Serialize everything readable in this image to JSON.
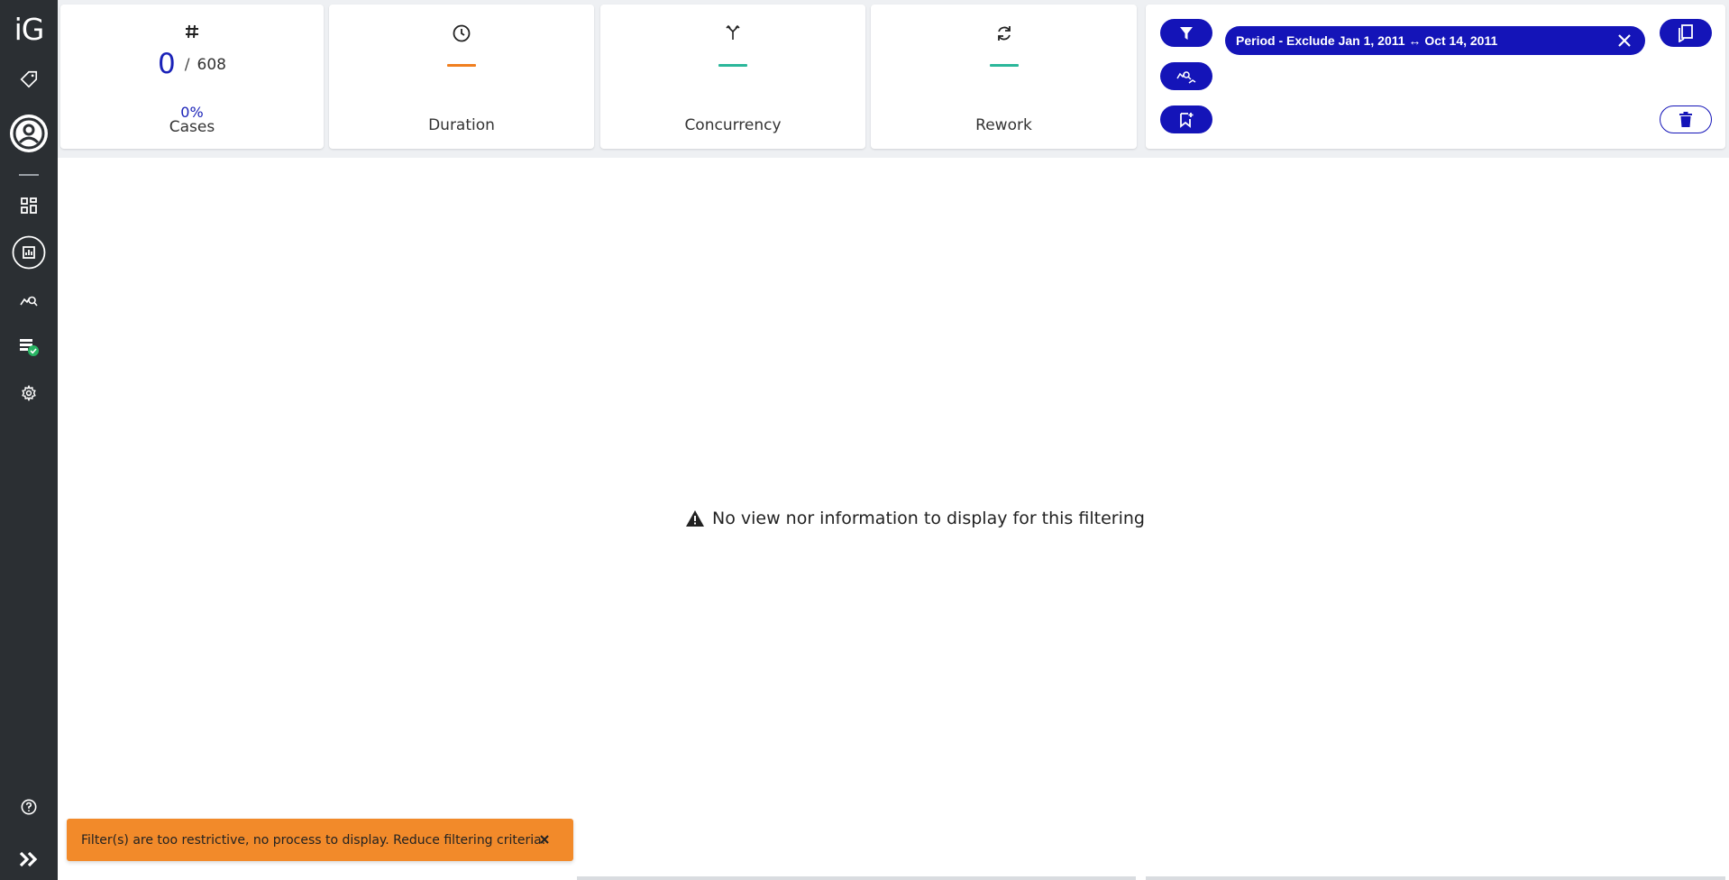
{
  "app": {
    "logo_text": "iG"
  },
  "sidebar": {
    "items": [
      {
        "icon": "tag-icon"
      },
      {
        "icon": "user-circle-icon"
      },
      {
        "icon": "dashboard-grid-icon"
      },
      {
        "icon": "report-chart-icon"
      },
      {
        "icon": "process-analysis-icon"
      },
      {
        "icon": "data-check-icon"
      },
      {
        "icon": "gear-icon"
      },
      {
        "icon": "help-icon"
      },
      {
        "icon": "expand-chevrons-icon"
      }
    ]
  },
  "stats": {
    "cases": {
      "value": "0",
      "separator": "/",
      "total": "608",
      "percent": "0%",
      "label": "Cases"
    },
    "duration": {
      "label": "Duration",
      "accent": "#f07f1f"
    },
    "concurrency": {
      "label": "Concurrency",
      "accent": "#2bb79a"
    },
    "rework": {
      "label": "Rework",
      "accent": "#2bb79a"
    }
  },
  "filters": {
    "active": [
      {
        "label": "Period - Exclude Jan 1, 2011 ↔ Oct 14, 2011"
      }
    ]
  },
  "main": {
    "empty_message": "No view nor information to display for this filtering"
  },
  "toast": {
    "message": "Filter(s) are too restrictive, no process to display. Reduce filtering criteria."
  },
  "colors": {
    "primary": "#1414b8",
    "sidebar_bg": "#2b2f33",
    "warning": "#f28a2a"
  }
}
